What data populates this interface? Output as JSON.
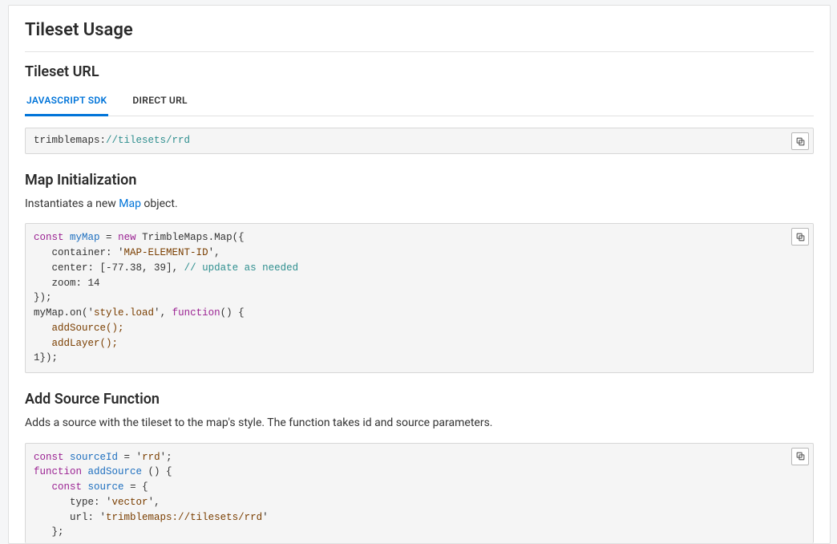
{
  "page_title": "Tileset Usage",
  "sections": {
    "url": {
      "heading": "Tileset URL",
      "tabs": [
        "JAVASCRIPT SDK",
        "DIRECT URL"
      ],
      "active_tab": 0,
      "code": {
        "scheme_prefix": "trimblemaps:",
        "path": "//tilesets/rrd"
      }
    },
    "init": {
      "heading": "Map Initialization",
      "desc_prefix": "Instantiates a new ",
      "desc_link": "Map",
      "desc_suffix": " object.",
      "code": {
        "const": "const",
        "var_map": "myMap",
        "eq": " = ",
        "new": "new",
        "ctor": " TrimbleMaps.Map({",
        "container_key": "container",
        "container_val": "MAP-ELEMENT-ID",
        "center_key": "center",
        "center_val": "[-77.38, 39]",
        "center_comment": "// update as needed",
        "zoom_key": "zoom",
        "zoom_val": "14",
        "close_obj": "});",
        "on_line_pre": "myMap.on(",
        "on_event": "style.load",
        "on_mid": ", ",
        "function_kw": "function",
        "on_post": "() {",
        "add_source_call": "addSource();",
        "add_layer_call": "addLayer();",
        "tail": "1});"
      }
    },
    "source": {
      "heading": "Add Source Function",
      "desc": "Adds a source with the tileset to the map's style. The function takes id and source parameters.",
      "code": {
        "const": "const",
        "sourceId_var": "sourceId",
        "eq": " = ",
        "id_val": "rrd",
        "semi": ";",
        "function_kw": "function",
        "fn_name": "addSource",
        "fn_sig": " () {",
        "const2": "const",
        "source_var": "source",
        "source_eq": " = {",
        "type_key": "type",
        "type_val": "vector",
        "url_key": "url",
        "url_val": "trimblemaps://tilesets/rrd",
        "close": "};"
      }
    }
  },
  "copy_label": "Copy"
}
